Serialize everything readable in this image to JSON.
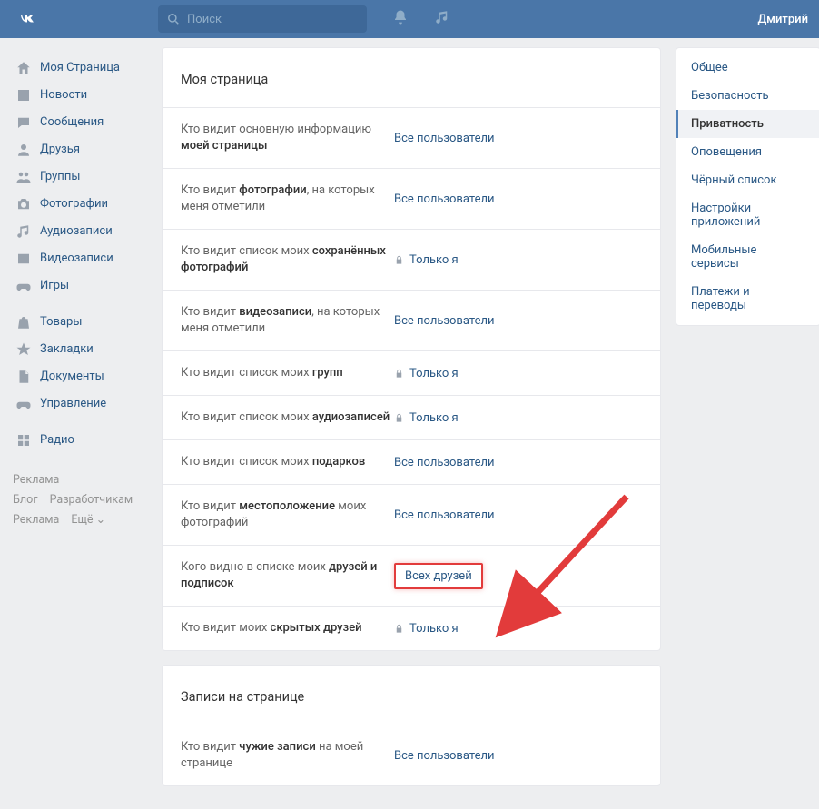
{
  "header": {
    "search_placeholder": "Поиск",
    "username": "Дмитрий"
  },
  "sidebar": {
    "items": [
      {
        "label": "Моя Страница",
        "icon": "home-icon"
      },
      {
        "label": "Новости",
        "icon": "news-icon"
      },
      {
        "label": "Сообщения",
        "icon": "messages-icon"
      },
      {
        "label": "Друзья",
        "icon": "friends-icon"
      },
      {
        "label": "Группы",
        "icon": "groups-icon"
      },
      {
        "label": "Фотографии",
        "icon": "camera-icon"
      },
      {
        "label": "Аудиозаписи",
        "icon": "music-icon"
      },
      {
        "label": "Видеозаписи",
        "icon": "video-icon"
      },
      {
        "label": "Игры",
        "icon": "games-icon"
      }
    ],
    "items2": [
      {
        "label": "Товары",
        "icon": "market-icon"
      },
      {
        "label": "Закладки",
        "icon": "star-icon"
      },
      {
        "label": "Документы",
        "icon": "docs-icon"
      },
      {
        "label": "Управление",
        "icon": "gamepad-icon"
      }
    ],
    "items3": [
      {
        "label": "Радио",
        "icon": "radio-icon"
      }
    ]
  },
  "footer": {
    "reklama1": "Реклама",
    "blog": "Блог",
    "dev": "Разработчикам",
    "reklama2": "Реклама",
    "more": "Ещё ⌄"
  },
  "sections": [
    {
      "title": "Моя страница",
      "rows": [
        {
          "pre": "Кто видит основную информацию ",
          "bold": "моей страницы",
          "post": "",
          "value": "Все пользователи",
          "locked": false
        },
        {
          "pre": "Кто видит ",
          "bold": "фотографии",
          "post": ", на которых меня отметили",
          "value": "Все пользователи",
          "locked": false
        },
        {
          "pre": "Кто видит список моих ",
          "bold": "сохранённых фотографий",
          "post": "",
          "value": "Только я",
          "locked": true
        },
        {
          "pre": "Кто видит ",
          "bold": "видеозаписи",
          "post": ", на которых меня отметили",
          "value": "Все пользователи",
          "locked": false
        },
        {
          "pre": "Кто видит список моих ",
          "bold": "групп",
          "post": "",
          "value": "Только я",
          "locked": true
        },
        {
          "pre": "Кто видит список моих ",
          "bold": "аудиозаписей",
          "post": "",
          "value": "Только я",
          "locked": true
        },
        {
          "pre": "Кто видит список моих ",
          "bold": "подарков",
          "post": "",
          "value": "Все пользователи",
          "locked": false
        },
        {
          "pre": "Кто видит ",
          "bold": "местоположение",
          "post": " моих фотографий",
          "value": "Все пользователи",
          "locked": false
        },
        {
          "pre": "Кого видно в списке моих ",
          "bold": "друзей и подписок",
          "post": "",
          "value": "Всех друзей",
          "locked": false,
          "highlight": true
        },
        {
          "pre": "Кто видит моих ",
          "bold": "скрытых друзей",
          "post": "",
          "value": "Только я",
          "locked": true
        }
      ]
    },
    {
      "title": "Записи на странице",
      "rows": [
        {
          "pre": "Кто видит ",
          "bold": "чужие записи",
          "post": " на моей странице",
          "value": "Все пользователи",
          "locked": false
        }
      ]
    }
  ],
  "rail": [
    {
      "label": "Общее"
    },
    {
      "label": "Безопасность"
    },
    {
      "label": "Приватность",
      "active": true
    },
    {
      "label": "Оповещения"
    },
    {
      "label": "Чёрный список"
    },
    {
      "label": "Настройки приложений"
    },
    {
      "label": "Мобильные сервисы"
    },
    {
      "label": "Платежи и переводы"
    }
  ]
}
